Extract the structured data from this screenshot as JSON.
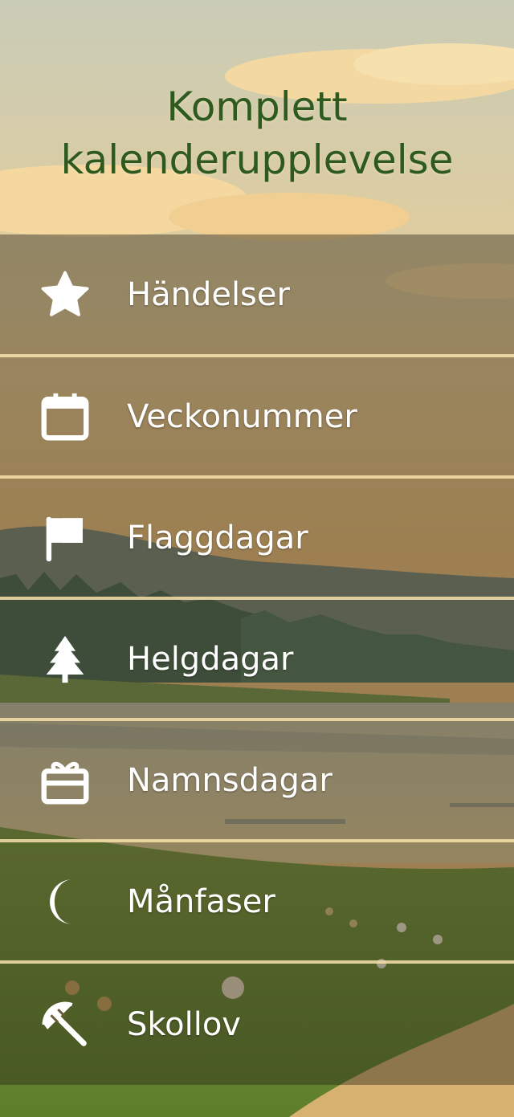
{
  "title": {
    "line1": "Komplett",
    "line2": "kalenderupplevelse"
  },
  "colors": {
    "title": "#2e5a1f",
    "divider": "#f8e2aa",
    "label": "#ffffff"
  },
  "menu": {
    "items": [
      {
        "label": "Händelser",
        "icon": "star-icon"
      },
      {
        "label": "Veckonummer",
        "icon": "calendar-icon"
      },
      {
        "label": "Flaggdagar",
        "icon": "flag-icon"
      },
      {
        "label": "Helgdagar",
        "icon": "tree-icon"
      },
      {
        "label": "Namnsdagar",
        "icon": "gift-icon"
      },
      {
        "label": "Månfaser",
        "icon": "moon-icon"
      },
      {
        "label": "Skollov",
        "icon": "umbrella-icon"
      }
    ]
  }
}
